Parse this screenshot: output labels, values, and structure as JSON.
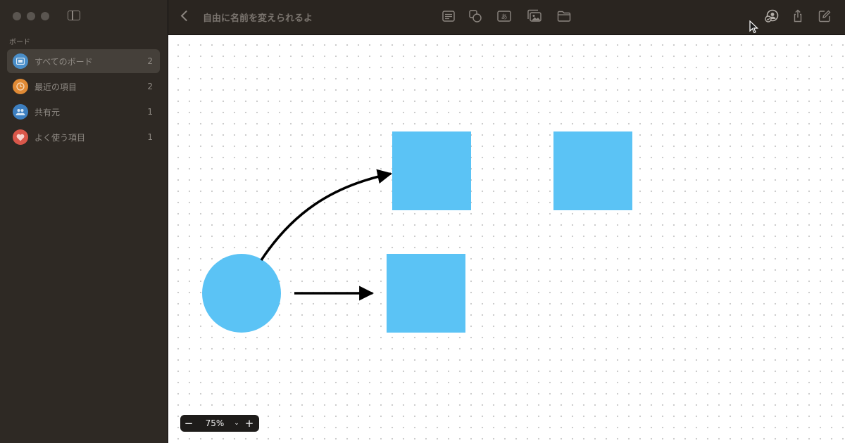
{
  "sidebar": {
    "section_label": "ボード",
    "items": [
      {
        "label": "すべてのボード",
        "count": "2",
        "icon": "boards-icon",
        "color": "#4a8ec9",
        "selected": true
      },
      {
        "label": "最近の項目",
        "count": "2",
        "icon": "clock-icon",
        "color": "#e08a35",
        "selected": false
      },
      {
        "label": "共有元",
        "count": "1",
        "icon": "people-icon",
        "color": "#3d7fc0",
        "selected": false
      },
      {
        "label": "よく使う項目",
        "count": "1",
        "icon": "heart-icon",
        "color": "#d9574a",
        "selected": false
      }
    ]
  },
  "titlebar": {
    "title": "自由に名前を変えられるよ",
    "toolbar_icons": [
      "sticky-note-icon",
      "shapes-icon",
      "text-box-icon",
      "media-icon",
      "folder-icon",
      "collaborate-icon",
      "share-icon",
      "compose-icon"
    ]
  },
  "canvas": {
    "shape_color": "#5bc3f5",
    "connector_color": "#000000",
    "shapes": [
      "circle",
      "square",
      "square",
      "square"
    ],
    "connectors": [
      "curved-arrow",
      "straight-arrow"
    ]
  },
  "zoom": {
    "value": "75%",
    "minus": "−",
    "plus": "+",
    "caret": "⌄"
  }
}
